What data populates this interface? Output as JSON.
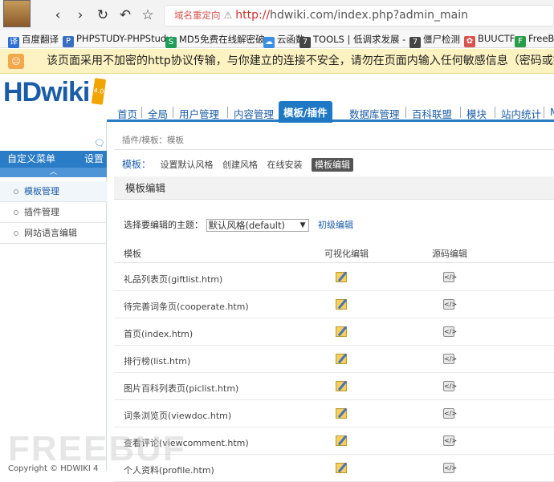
{
  "browser": {
    "nav": {
      "back": "‹",
      "forward": "›",
      "reload": "↻",
      "undo": "↶",
      "favorite": "☆"
    },
    "url": {
      "redirect_note": "域名重定向",
      "protocol": "http://",
      "rest": "hdwiki.com/index.php?admin_main"
    }
  },
  "bookmarks": [
    {
      "label": "百度翻译",
      "icon": "译",
      "color": "#2d6fd6"
    },
    {
      "label": "PHPSTUDY-PHPStudy",
      "icon": "P",
      "color": "#3a6fc0"
    },
    {
      "label": "MD5免费在线解密破",
      "icon": "S",
      "color": "#1f9e5a"
    },
    {
      "label": "云函数",
      "icon": "☁",
      "color": "#3b8fe0"
    },
    {
      "label": "TOOLS | 低调求发展 -",
      "icon": "7",
      "color": "#444444"
    },
    {
      "label": "僵尸检测",
      "icon": "7",
      "color": "#444444"
    },
    {
      "label": "BUUCTF",
      "icon": "✿",
      "color": "#d9534f"
    },
    {
      "label": "FreeBu",
      "icon": "F",
      "color": "#2a9d4a"
    }
  ],
  "warning": {
    "text": "该页面采用不加密的http协议传输，与你建立的连接不安全，请勿在页面内输入任何敏感信息（密码或银行卡"
  },
  "logo": {
    "text": "HDwiki",
    "badge": "4.0"
  },
  "main_nav": [
    {
      "label": "首页",
      "active": false
    },
    {
      "label": "全局",
      "active": false
    },
    {
      "label": "用户管理",
      "active": false
    },
    {
      "label": "内容管理",
      "active": false
    },
    {
      "label": "模板/插件",
      "active": true
    },
    {
      "label": "数据库管理",
      "active": false
    },
    {
      "label": "百科联盟",
      "active": false
    },
    {
      "label": "模块",
      "active": false
    },
    {
      "label": "站内统计",
      "active": false
    },
    {
      "label": "M",
      "active": false
    }
  ],
  "sidebar": {
    "title": "自定义菜单",
    "settings": "设置",
    "collapse": "︿",
    "items": [
      {
        "label": "模板管理",
        "selected": true
      },
      {
        "label": "插件管理",
        "selected": false
      },
      {
        "label": "网站语言编辑",
        "selected": false
      }
    ]
  },
  "content": {
    "breadcrumb": "插件/模板：模板",
    "subnav": {
      "head": "模板：",
      "items": [
        "设置默认风格",
        "创建风格",
        "在线安装"
      ],
      "active": "模板编辑"
    },
    "section_title": "模板编辑",
    "theme_label": "选择要编辑的主题：",
    "theme_value": "默认风格(default)",
    "basic_edit": "初级编辑",
    "columns": {
      "template": "模板",
      "visual": "可视化编辑",
      "source": "源码编辑"
    },
    "rows": [
      "礼品列表页(giftlist.htm)",
      "待完善词条页(cooperate.htm)",
      "首页(index.htm)",
      "排行榜(list.htm)",
      "图片百科列表页(piclist.htm)",
      "词条浏览页(viewdoc.htm)",
      "查看评论(viewcomment.htm)",
      "个人资料(profile.htm)"
    ]
  },
  "watermark": "FREEBUF",
  "footer": "Copyright © HDWIKI 4"
}
